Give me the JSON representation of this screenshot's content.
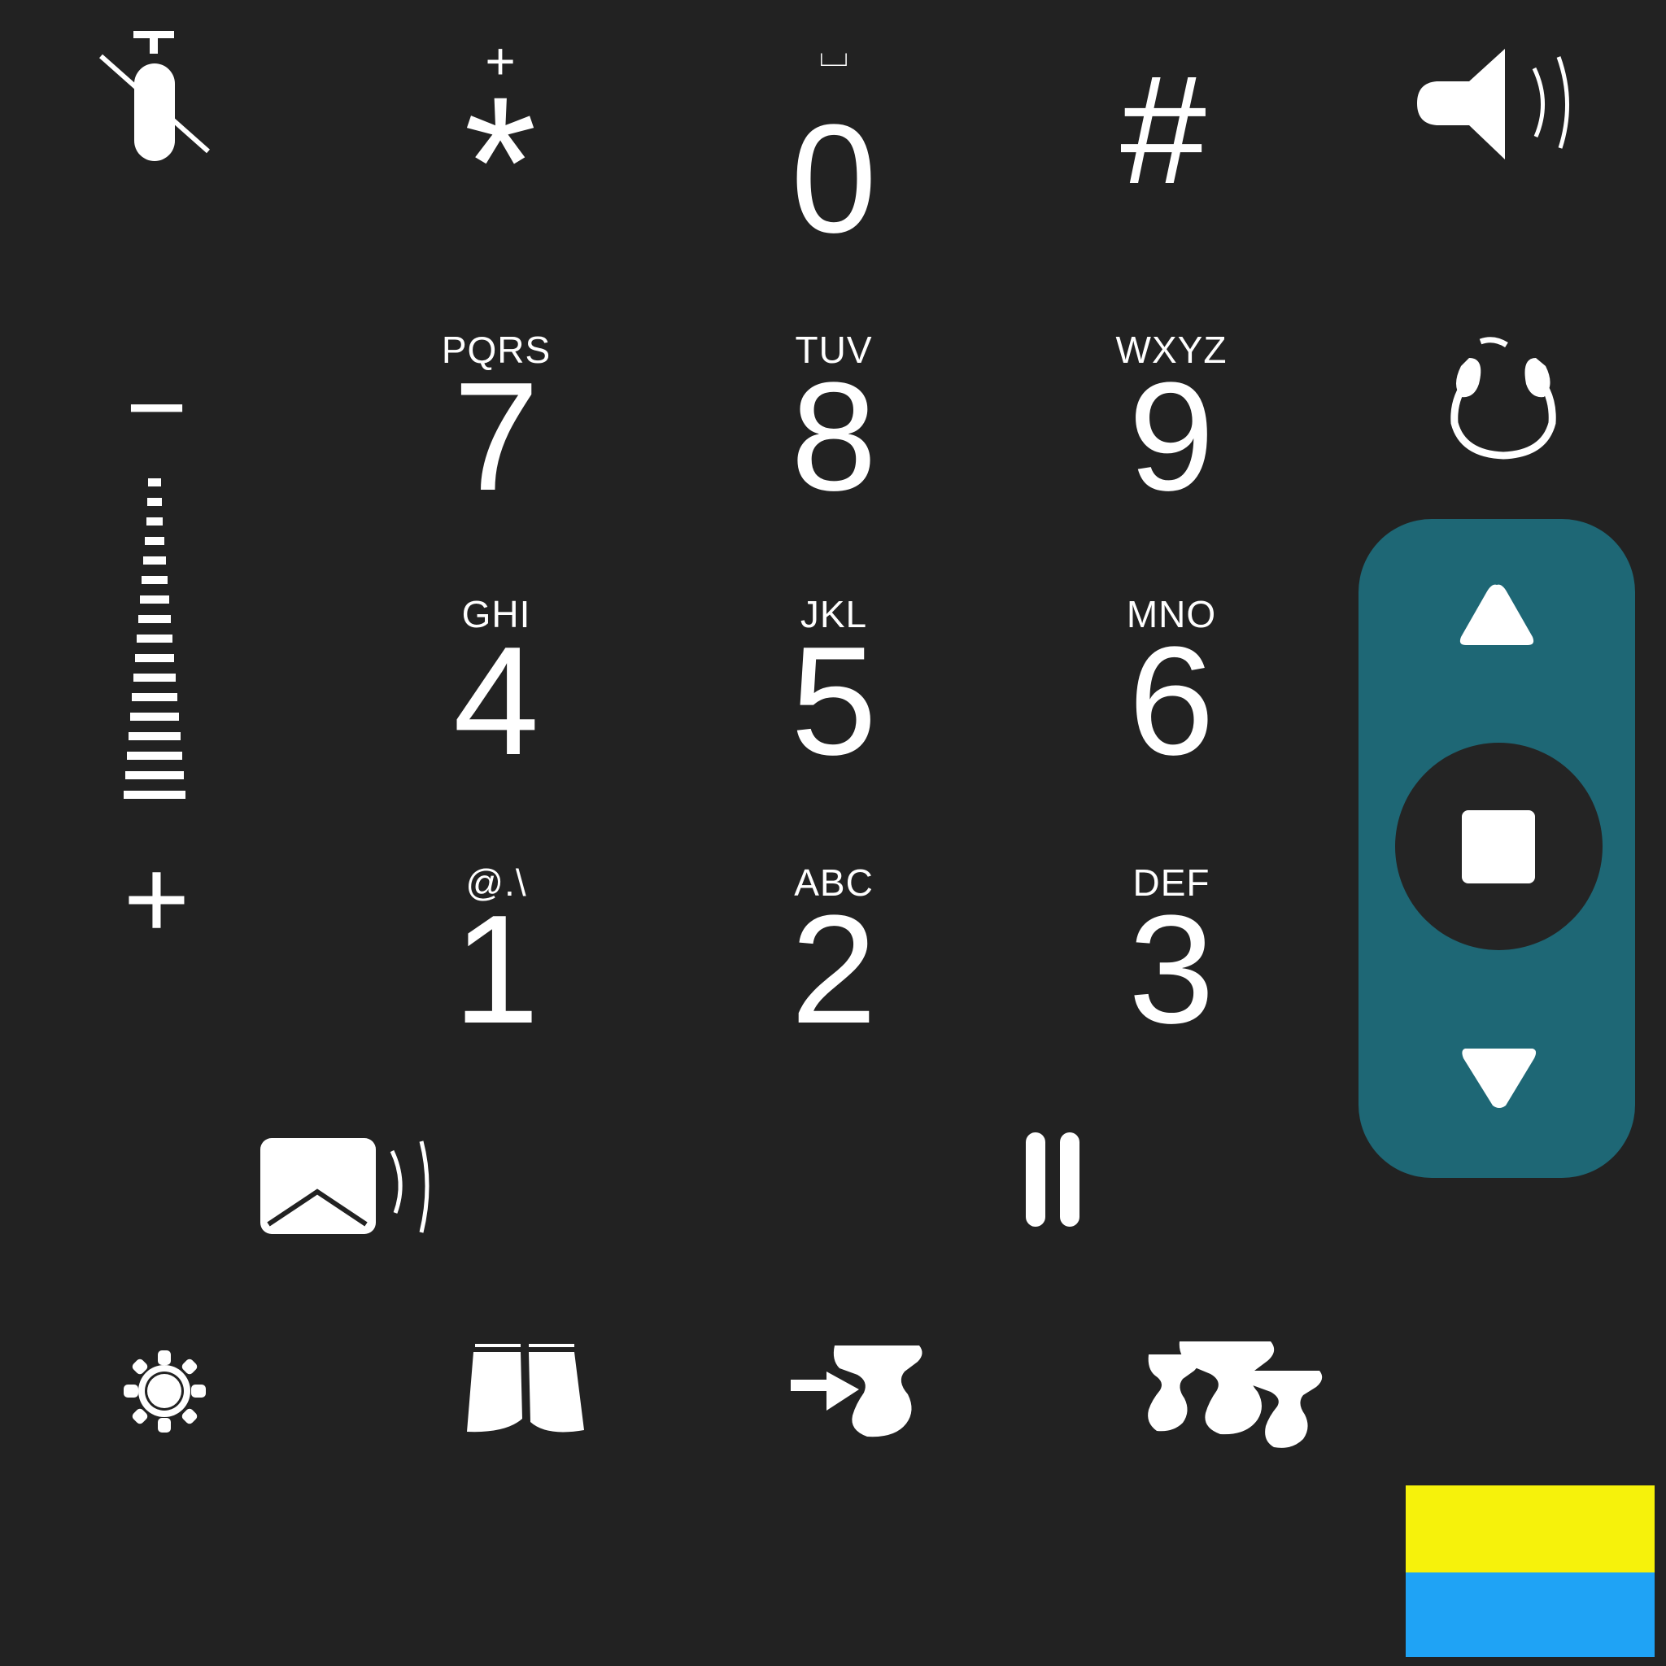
{
  "dialpad": {
    "top_row": {
      "star": {
        "sub": "+",
        "main": "*"
      },
      "zero": {
        "sub": "⌴",
        "main": "0"
      },
      "hash": {
        "main": "#"
      }
    },
    "keys": [
      {
        "letters": "PQRS",
        "digit": "7"
      },
      {
        "letters": "TUV",
        "digit": "8"
      },
      {
        "letters": "WXYZ",
        "digit": "9"
      },
      {
        "letters": "GHI",
        "digit": "4"
      },
      {
        "letters": "JKL",
        "digit": "5"
      },
      {
        "letters": "MNO",
        "digit": "6"
      },
      {
        "letters": "@.\\",
        "digit": "1"
      },
      {
        "letters": "ABC",
        "digit": "2"
      },
      {
        "letters": "DEF",
        "digit": "3"
      }
    ]
  },
  "volume": {
    "minus": "−",
    "plus": "+"
  },
  "icons": [
    "mute-microphone-icon",
    "speaker-volume-icon",
    "headset-icon",
    "send-wave-icon",
    "pause-icon",
    "gear-icon",
    "book-icon",
    "transfer-icon",
    "conference-icon",
    "arrow-up-icon",
    "stop-icon",
    "arrow-down-icon"
  ],
  "colors": {
    "background": "#222222",
    "nav_panel": "#1e6775",
    "nav_center": "#242424",
    "flag_yellow": "#f6f20b",
    "flag_blue": "#1fa3f5"
  }
}
